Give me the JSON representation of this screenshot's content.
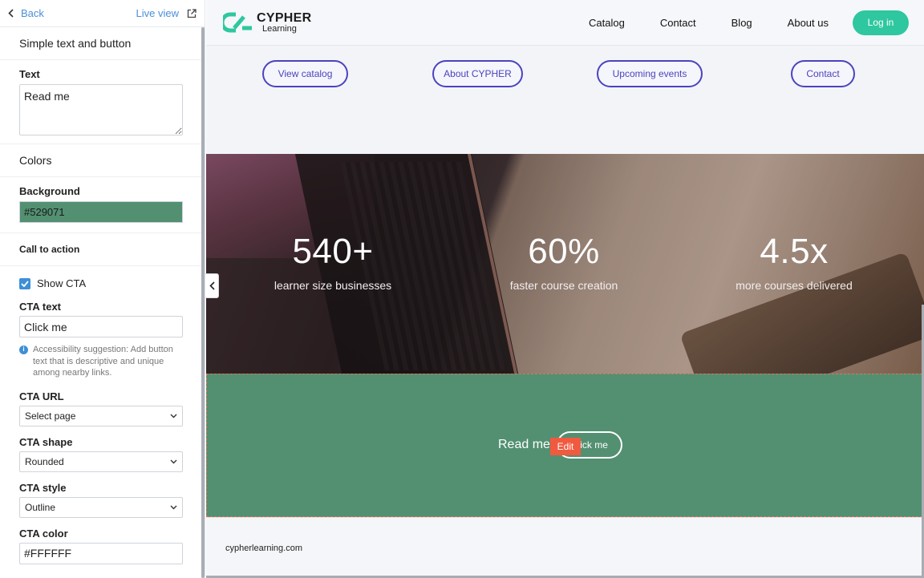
{
  "editor": {
    "back_label": "Back",
    "live_view_label": "Live view",
    "section_title": "Simple text and button",
    "text_label": "Text",
    "text_value": "Read me",
    "colors_title": "Colors",
    "background_label": "Background",
    "background_value": "#529071",
    "cta_section_title": "Call to action",
    "show_cta_label": "Show CTA",
    "show_cta_checked": true,
    "cta_text_label": "CTA text",
    "cta_text_value": "Click me",
    "accessibility_hint": "Accessibility suggestion: Add button text that is descriptive and unique among nearby links.",
    "cta_url_label": "CTA URL",
    "cta_url_value": "Select page",
    "cta_shape_label": "CTA shape",
    "cta_shape_value": "Rounded",
    "cta_style_label": "CTA style",
    "cta_style_value": "Outline",
    "cta_color_label": "CTA color",
    "cta_color_value": "#FFFFFF"
  },
  "site": {
    "logo_line1": "CYPHER",
    "logo_line2": "Learning",
    "nav": [
      "Catalog",
      "Contact",
      "Blog",
      "About us"
    ],
    "login_label": "Log in",
    "accent_color": "#2ec79f",
    "quick_links": [
      "View catalog",
      "About CYPHER",
      "Upcoming events",
      "Contact"
    ],
    "stats": [
      {
        "value": "540+",
        "caption": "learner size businesses"
      },
      {
        "value": "60%",
        "caption": "faster course creation"
      },
      {
        "value": "4.5x",
        "caption": "more courses delivered"
      }
    ],
    "cta_block": {
      "text": "Read me",
      "button_label": "Click me",
      "background": "#529071",
      "edit_tag": "Edit"
    },
    "footer_domain": "cypherlearning.com"
  }
}
